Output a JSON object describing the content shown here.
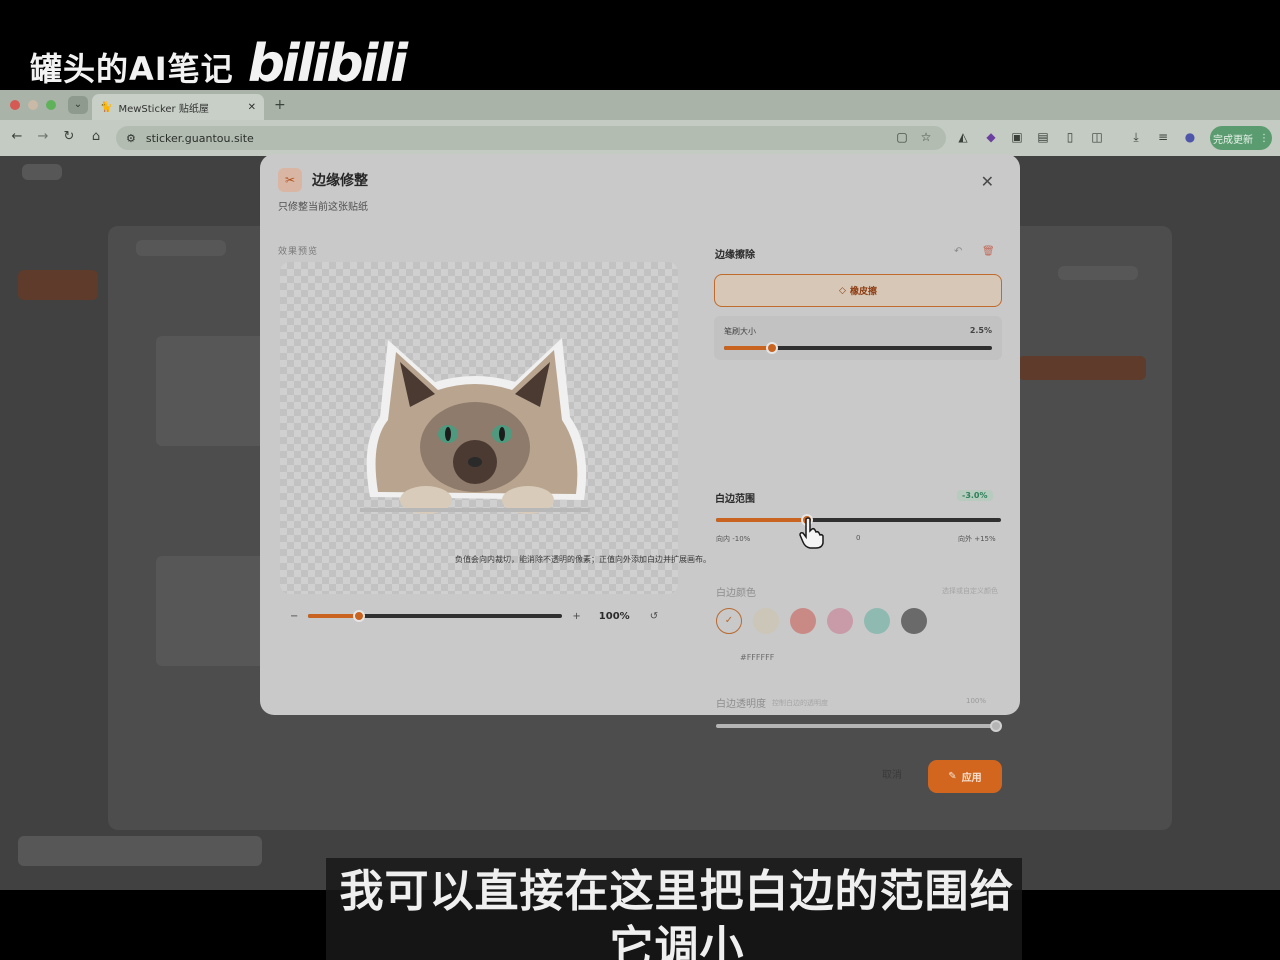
{
  "overlay": {
    "channel_name": "罐头的AI笔记",
    "platform_logo": "bilibili"
  },
  "browser": {
    "tab_title": "MewSticker 贴纸屋",
    "address": "sticker.guantou.site",
    "update_button": "完成更新"
  },
  "modal": {
    "title": "边缘修整",
    "subtitle": "只修整当前这张贴纸",
    "preview_label": "效果预览",
    "zoom_percent": "100%",
    "zoom_level": 0.2,
    "edge_section_title": "边缘擦除",
    "eraser_button": "橡皮擦",
    "brush_size_label": "笔刷大小",
    "brush_size_value": "2.5%",
    "brush_level": 0.18,
    "white_range_title": "白边范围",
    "white_range_value": "-3.0%",
    "white_range_level": 0.32,
    "range_min": "向内 -10%",
    "range_zero": "0",
    "range_max": "向外 +15%",
    "help_text": "负值会向内裁切，能消除不透明的像素；正值向外添加白边并扩展画布。",
    "color_label": "白边颜色",
    "color_hint": "选择或自定义颜色",
    "hex_value": "#FFFFFF",
    "opacity_label": "白边透明度",
    "opacity_hint": "控制白边的透明度",
    "opacity_value": "100%",
    "cancel_button": "取消",
    "apply_button": "应用"
  },
  "colors": {
    "accent": "#c8641f",
    "apply_bg": "#d3661e",
    "swatches": [
      "#c9c9c9",
      "#ccc6b8",
      "#c98a86",
      "#c99aa8",
      "#8fbab1",
      "#6a6a6a"
    ]
  },
  "subtitle": "我可以直接在这里把白边的范围给它调小"
}
